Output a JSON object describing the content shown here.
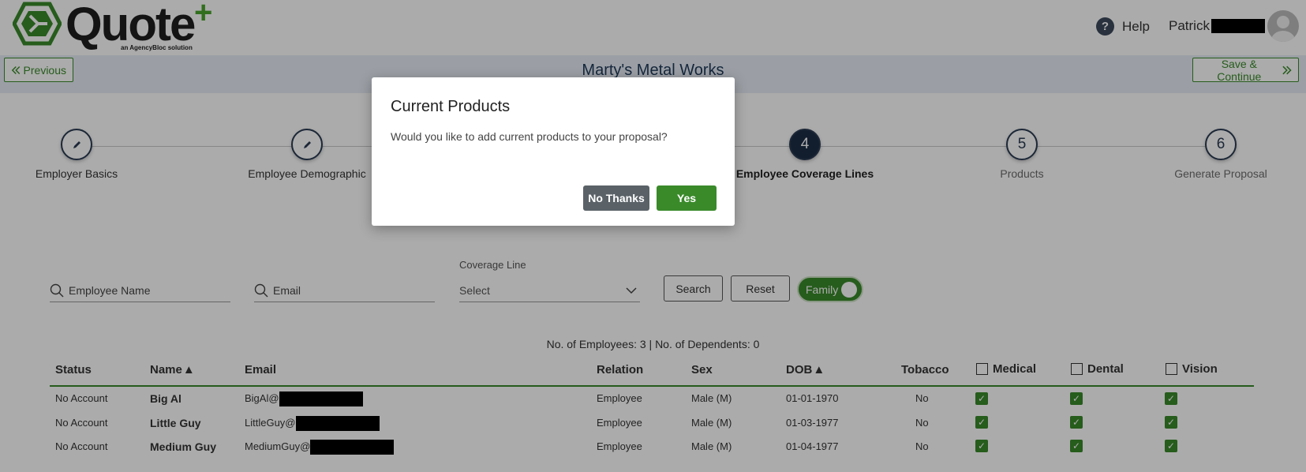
{
  "header": {
    "logo_word": "Quote",
    "logo_plus": "+",
    "logo_tagline": "an AgencyBloc solution",
    "help_label": "Help",
    "user_name": "Patrick"
  },
  "nav": {
    "previous_label": "Previous",
    "save_label": "Save & Continue",
    "page_title": "Marty's Metal Works"
  },
  "stepper": {
    "steps": [
      {
        "number": "",
        "label": "Employer Basics",
        "state": "done"
      },
      {
        "number": "",
        "label": "Employee Demographic",
        "state": "done"
      },
      {
        "number": "4",
        "label": "Employee Coverage Lines",
        "state": "active"
      },
      {
        "number": "5",
        "label": "Products",
        "state": "pending"
      },
      {
        "number": "6",
        "label": "Generate Proposal",
        "state": "pending"
      }
    ]
  },
  "filters": {
    "employee_name_placeholder": "Employee Name",
    "email_placeholder": "Email",
    "coverage_label": "Coverage Line",
    "coverage_value": "Select",
    "search_label": "Search",
    "reset_label": "Reset",
    "family_label": "Family"
  },
  "counts": "No. of Employees: 3 | No. of Dependents: 0",
  "table": {
    "headers": {
      "status": "Status",
      "name": "Name",
      "email": "Email",
      "relation": "Relation",
      "sex": "Sex",
      "dob": "DOB",
      "tobacco": "Tobacco",
      "medical": "Medical",
      "dental": "Dental",
      "vision": "Vision"
    },
    "sort_arrow": "▲",
    "rows": [
      {
        "status": "No Account",
        "name": "Big Al",
        "email": "BigAl@",
        "relation": "Employee",
        "sex": "Male (M)",
        "dob": "01-01-1970",
        "tobacco": "No",
        "medical": true,
        "dental": true,
        "vision": true
      },
      {
        "status": "No Account",
        "name": "Little Guy",
        "email": "LittleGuy@",
        "relation": "Employee",
        "sex": "Male (M)",
        "dob": "01-03-1977",
        "tobacco": "No",
        "medical": true,
        "dental": true,
        "vision": true
      },
      {
        "status": "No Account",
        "name": "Medium Guy",
        "email": "MediumGuy@",
        "relation": "Employee",
        "sex": "Male (M)",
        "dob": "01-04-1977",
        "tobacco": "No",
        "medical": true,
        "dental": true,
        "vision": true
      }
    ]
  },
  "modal": {
    "title": "Current Products",
    "body": "Would you like to add current products to your proposal?",
    "no_label": "No Thanks",
    "yes_label": "Yes"
  },
  "colors": {
    "brand_green": "#3a8a2a",
    "navy": "#1c2d45",
    "overlay": "rgba(0,0,0,0.33)"
  },
  "icons": {
    "previous": "double-chevron-left-icon",
    "save": "double-chevron-right-icon",
    "help": "question-circle-icon",
    "avatar": "user-avatar-icon",
    "step_done": "pencil-icon",
    "search": "search-icon",
    "dropdown": "chevron-down-icon",
    "checkbox": "checkbox-checked-icon"
  }
}
